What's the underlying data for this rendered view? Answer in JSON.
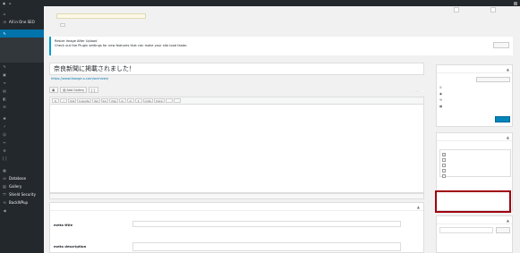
{
  "adminbar": {
    "site_name": "",
    "updates": "",
    "comments": "",
    "new": "",
    "howdy": ""
  },
  "notice": {
    "text": ""
  },
  "screen_options": {
    "screen_label": "",
    "help_label": ""
  },
  "sidebar": {
    "items": [
      {
        "label": "",
        "icon": "home-icon"
      },
      {
        "label": "All in One SEO",
        "icon": "seo-icon"
      },
      {
        "label": "",
        "icon": "pin-icon",
        "active": true
      }
    ],
    "submenu": [
      {
        "label": "",
        "current": true
      },
      {
        "label": ""
      },
      {
        "label": ""
      },
      {
        "label": ""
      }
    ],
    "items2": [
      {
        "label": "",
        "icon": "pin-icon"
      },
      {
        "label": "",
        "icon": "media-icon"
      },
      {
        "label": "",
        "icon": "link-icon"
      },
      {
        "label": "",
        "icon": "page-icon"
      },
      {
        "label": "",
        "icon": "comment-icon"
      },
      {
        "label": "",
        "icon": "mail-icon"
      },
      {
        "label": "",
        "icon": "appearance-icon"
      },
      {
        "label": "",
        "icon": "plugin-icon",
        "badge": ""
      },
      {
        "label": "",
        "icon": "user-icon"
      },
      {
        "label": "",
        "icon": "tool-icon"
      },
      {
        "label": "",
        "icon": "settings-icon"
      },
      {
        "label": "",
        "icon": "shortcode-icon"
      },
      {
        "label": "",
        "icon": "dashboard-icon"
      },
      {
        "label": "Database",
        "icon": "database-icon"
      },
      {
        "label": "Gallery",
        "icon": "gallery-icon"
      },
      {
        "label": "Shield Security",
        "icon": "shield-icon"
      },
      {
        "label": "BackWPup",
        "icon": "backup-icon"
      },
      {
        "label": "",
        "icon": "collapse-icon"
      }
    ]
  },
  "page": {
    "title": "",
    "add_new": ""
  },
  "plugin_notice": {
    "heading": "Resize Image After Upload",
    "text": "Check out the Plugin settings for new features that can make your site load faster.",
    "dismiss": ""
  },
  "post": {
    "title": "奈良新聞に掲載されました！",
    "permalink_label": "",
    "permalink_url": "https://www.lbaxge-s.com/archives/"
  },
  "media_buttons": {
    "add_media": "",
    "add_gallery": "Add Gallery",
    "shortcode": ""
  },
  "editor_tabs": {
    "visual": "",
    "text": ""
  },
  "qt_buttons": [
    "b",
    "i",
    "link",
    "b-quote",
    "del",
    "ins",
    "img",
    "ul",
    "ol",
    "li",
    "code",
    "more",
    "",
    ""
  ],
  "editor_lines": [
    "",
    "",
    "",
    "",
    "",
    ""
  ],
  "status_bar": {
    "word_count": "",
    "last_edited": ""
  },
  "metabox": {
    "title": "",
    "meta_title_label": "meta title",
    "meta_title_help": "",
    "meta_desc_label": "meta description"
  },
  "publish_box": {
    "title": "",
    "preview": "",
    "status": "",
    "status_edit": "",
    "visibility": "",
    "visibility_edit": "",
    "revisions": "",
    "revisions_link": "",
    "published_on": "",
    "published_edit": "",
    "trash": "",
    "update": ""
  },
  "category_box": {
    "title": "",
    "tab_all": "",
    "tab_popular": "",
    "items": [
      {
        "label": "",
        "checked": true,
        "child": false
      },
      {
        "label": "",
        "checked": false,
        "child": false
      },
      {
        "label": "",
        "checked": false,
        "child": false
      },
      {
        "label": "",
        "checked": false,
        "child": false
      },
      {
        "label": "",
        "checked": false,
        "child": false
      }
    ],
    "add_new": ""
  },
  "tag_box": {
    "title": "",
    "add_button": "",
    "help": "",
    "choose_link": ""
  },
  "colors": {
    "admin_dark": "#23282d",
    "accent": "#0073aa",
    "primary_button": "#0085ba",
    "highlight": "#a0000f"
  }
}
